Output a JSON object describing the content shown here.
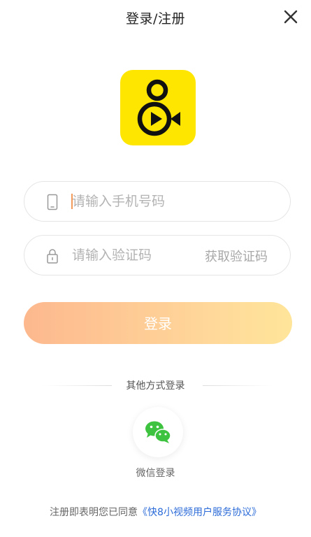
{
  "header": {
    "title": "登录/注册",
    "close_icon": "close-icon"
  },
  "logo": {
    "text": "8",
    "icon": "video-camera-icon",
    "background": "#FFE600"
  },
  "phone_field": {
    "placeholder": "请输入手机号码",
    "value": "",
    "icon": "phone-icon"
  },
  "code_field": {
    "placeholder": "请输入验证码",
    "value": "",
    "icon": "lock-icon",
    "get_code_label": "获取验证码"
  },
  "login_button": {
    "label": "登录",
    "gradient_start": "#FDB88E",
    "gradient_end": "#FFE59A"
  },
  "other_methods": {
    "label": "其他方式登录",
    "wechat_label": "微信登录",
    "wechat_icon": "wechat-icon",
    "wechat_color": "#3DC33F"
  },
  "agreement": {
    "prefix": "注册即表明您已同意",
    "link": "《快8小视频用户服务协议》",
    "link_color": "#2B6BD8"
  }
}
